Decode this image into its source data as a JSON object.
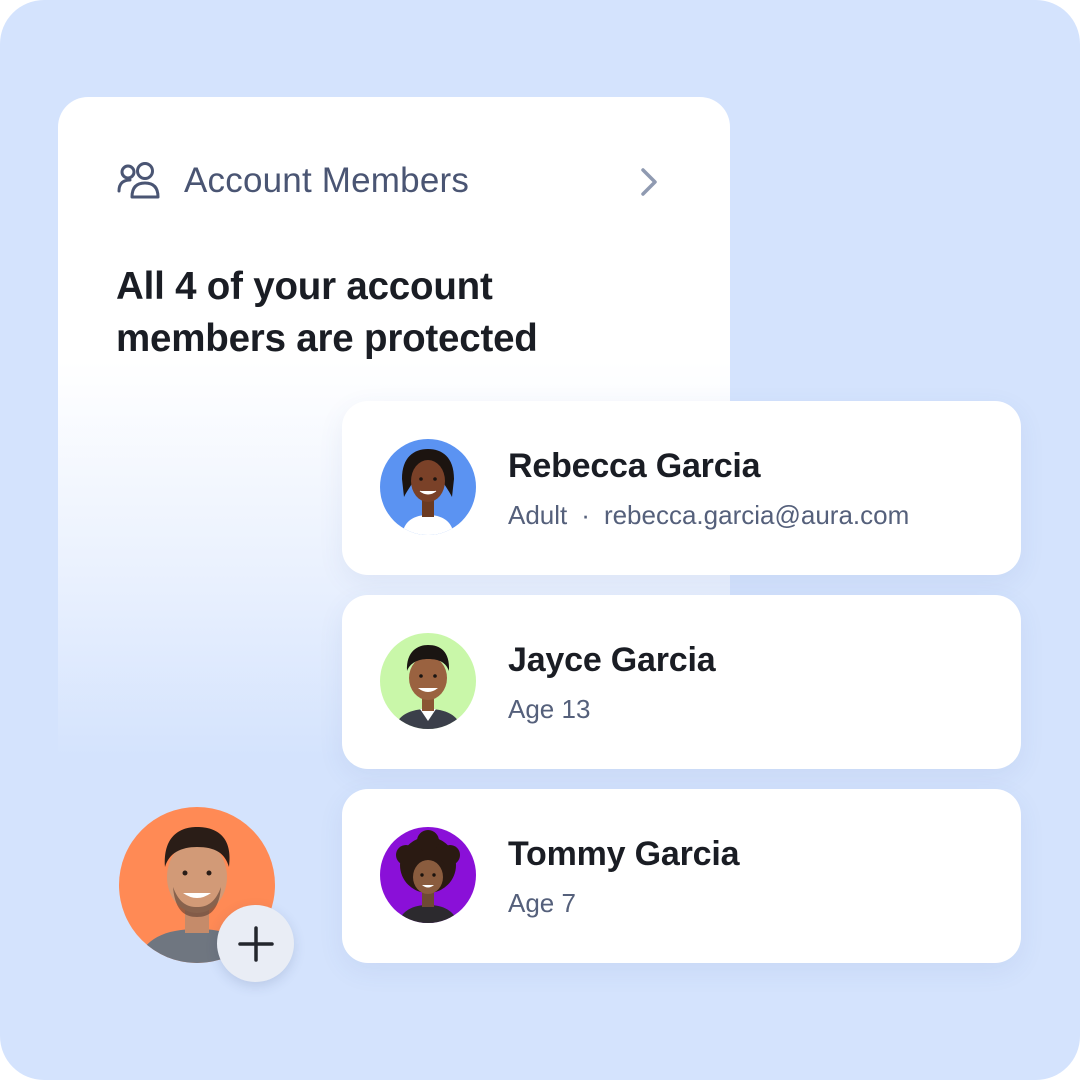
{
  "panel": {
    "title": "Account Members",
    "headline": "All 4 of your account members are protected"
  },
  "members": [
    {
      "name": "Rebecca Garcia",
      "type": "Adult",
      "email": "rebecca.garcia@aura.com",
      "avatar_color": "#5b93f2"
    },
    {
      "name": "Jayce Garcia",
      "detail": "Age 13",
      "avatar_color": "#c9f7a9"
    },
    {
      "name": "Tommy Garcia",
      "detail": "Age 7",
      "avatar_color": "#8a10d8"
    }
  ],
  "add_member": {
    "avatar_color": "#ff8a55",
    "icon": "plus-icon"
  },
  "colors": {
    "background": "#d4e3fd",
    "card": "#ffffff",
    "title_text": "#4a5573",
    "primary_text": "#1a1d24",
    "secondary_text": "#55607b"
  }
}
